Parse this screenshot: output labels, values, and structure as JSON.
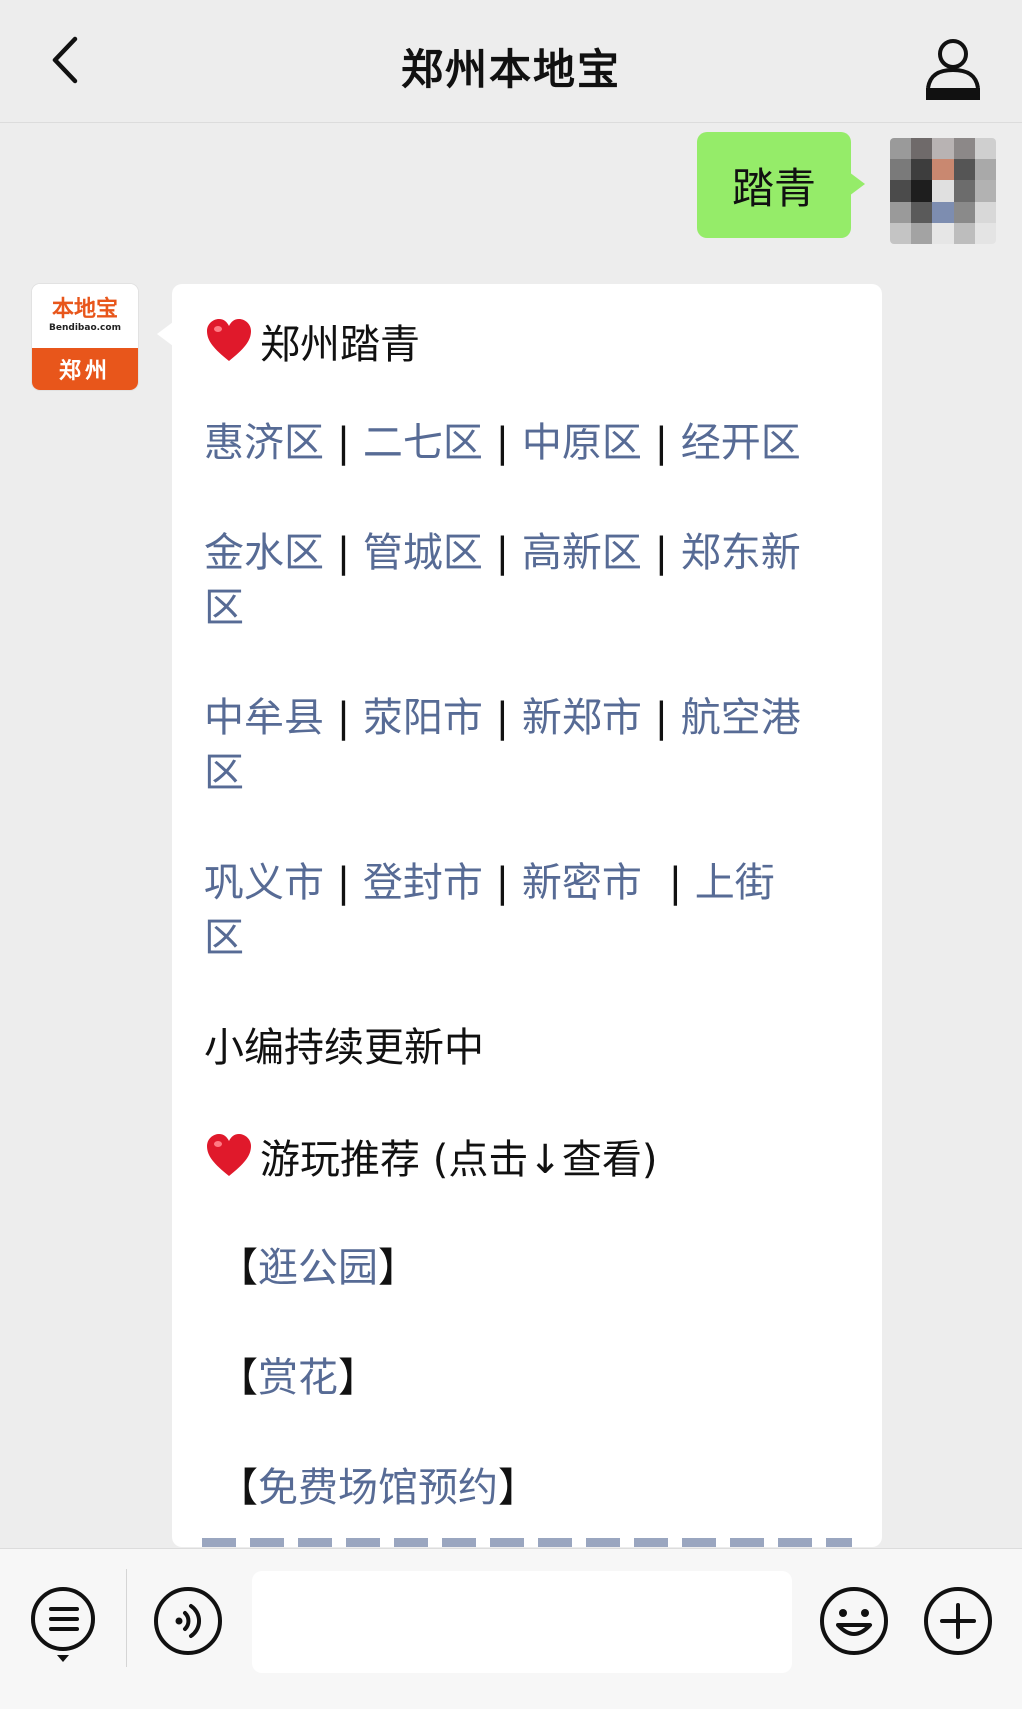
{
  "header": {
    "title": "郑州本地宝"
  },
  "my_message": {
    "text": "踏青"
  },
  "bot": {
    "avatar": {
      "logo_text": "本地宝",
      "logo_sub": "Bendibao.com",
      "city": "郑州"
    },
    "heading1": "郑州踏青",
    "rows": [
      {
        "links": [
          "惠济区",
          "二七区",
          "中原区",
          "经开区"
        ],
        "sep": "|"
      },
      {
        "links": [
          "金水区",
          "管城区",
          "高新区",
          "郑东新"
        ],
        "cont": "区",
        "sep": "|"
      },
      {
        "links": [
          "中牟县",
          "荥阳市",
          "新郑市",
          "航空港"
        ],
        "cont": "区",
        "sep": "|"
      },
      {
        "links": [
          "巩义市",
          "登封市",
          "新密市",
          "上街"
        ],
        "cont": "区",
        "sep": "|"
      }
    ],
    "updating": "小编持续更新中",
    "heading2": "游玩推荐 (点击↓查看)",
    "recommendations": [
      "逛公园",
      "赏花",
      "免费场馆预约"
    ],
    "bracket_open": "【",
    "bracket_close": "】"
  },
  "colors": {
    "link": "#576b95",
    "my_bubble": "#95ec69",
    "brand": "#e8561b"
  },
  "icons": [
    "back-icon",
    "profile-icon",
    "heart-icon",
    "menu-icon",
    "voice-icon",
    "emoji-icon",
    "plus-icon"
  ]
}
